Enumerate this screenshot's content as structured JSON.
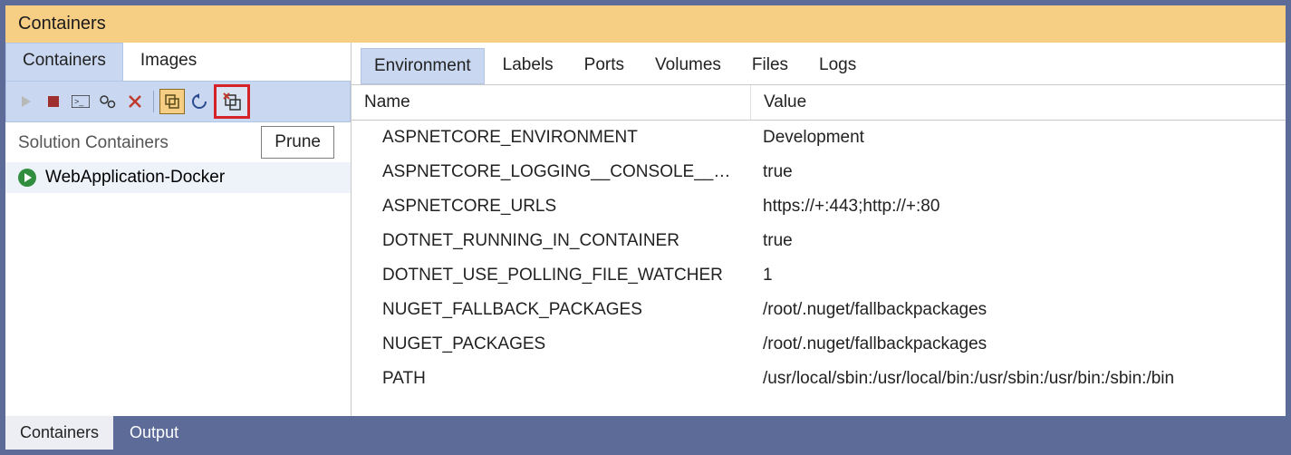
{
  "title": "Containers",
  "leftTabs": {
    "containers": "Containers",
    "images": "Images"
  },
  "toolbar": {
    "prune_tooltip": "Prune"
  },
  "section": {
    "header": "Solution Containers"
  },
  "tree": {
    "item0": "WebApplication-Docker"
  },
  "rightTabs": {
    "environment": "Environment",
    "labels": "Labels",
    "ports": "Ports",
    "volumes": "Volumes",
    "files": "Files",
    "logs": "Logs"
  },
  "grid": {
    "head_name": "Name",
    "head_value": "Value",
    "rows": [
      {
        "name": "ASPNETCORE_ENVIRONMENT",
        "value": "Development"
      },
      {
        "name": "ASPNETCORE_LOGGING__CONSOLE__DISA...",
        "value": "true"
      },
      {
        "name": "ASPNETCORE_URLS",
        "value": "https://+:443;http://+:80"
      },
      {
        "name": "DOTNET_RUNNING_IN_CONTAINER",
        "value": "true"
      },
      {
        "name": "DOTNET_USE_POLLING_FILE_WATCHER",
        "value": "1"
      },
      {
        "name": "NUGET_FALLBACK_PACKAGES",
        "value": "/root/.nuget/fallbackpackages"
      },
      {
        "name": "NUGET_PACKAGES",
        "value": "/root/.nuget/fallbackpackages"
      },
      {
        "name": "PATH",
        "value": "/usr/local/sbin:/usr/local/bin:/usr/sbin:/usr/bin:/sbin:/bin"
      }
    ]
  },
  "bottomTabs": {
    "containers": "Containers",
    "output": "Output"
  }
}
